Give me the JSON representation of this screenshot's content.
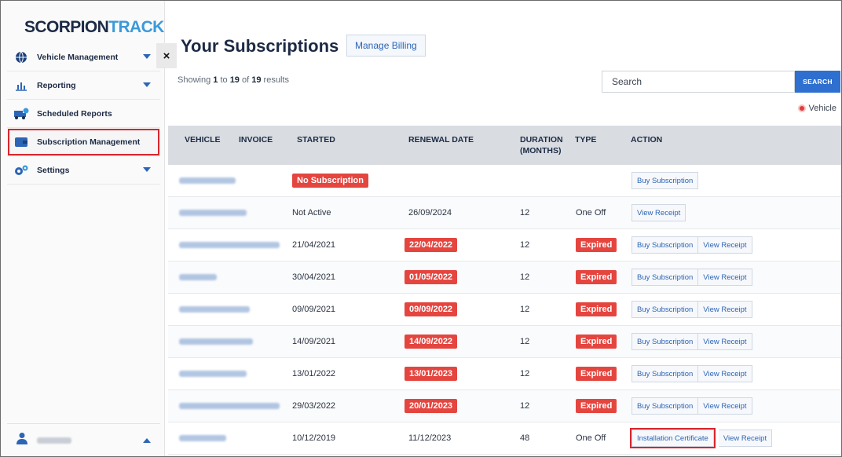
{
  "logo": {
    "part1": "SCORPION",
    "part2": "TRACK"
  },
  "sidebar": {
    "items": [
      {
        "label": "Vehicle Management",
        "icon": "globe-icon",
        "caret": true
      },
      {
        "label": "Reporting",
        "icon": "bar-chart-icon",
        "caret": true
      },
      {
        "label": "Scheduled Reports",
        "icon": "truck-clock-icon",
        "caret": false
      },
      {
        "label": "Subscription Management",
        "icon": "wallet-icon",
        "caret": false,
        "active": true
      },
      {
        "label": "Settings",
        "icon": "gears-icon",
        "caret": true
      }
    ],
    "close": "×"
  },
  "page": {
    "title": "Your Subscriptions",
    "manage_billing": "Manage Billing",
    "showing": {
      "prefix": "Showing ",
      "from": "1",
      "mid1": " to ",
      "to": "19",
      "mid2": " of ",
      "total": "19",
      "suffix": " results"
    },
    "search_placeholder": "Search",
    "search_button": "SEARCH",
    "legend_label": "Vehicle"
  },
  "table": {
    "headers": {
      "vehicle": "VEHICLE",
      "invoice": "INVOICE",
      "started": "STARTED",
      "renewal": "RENEWAL DATE",
      "duration_1": "DURATION",
      "duration_2": "(MONTHS)",
      "type": "TYPE",
      "action": "ACTION"
    },
    "rows": [
      {
        "started": "",
        "started_badge": "No Subscription",
        "renewal": "",
        "renewal_badge": "",
        "duration": "",
        "type": "",
        "type_badge": "",
        "actions": [
          "Buy Subscription"
        ]
      },
      {
        "started": "Not Active",
        "started_badge": "",
        "renewal": "26/09/2024",
        "renewal_badge": "",
        "duration": "12",
        "type": "One Off",
        "type_badge": "",
        "actions": [
          "View Receipt"
        ]
      },
      {
        "started": "21/04/2021",
        "started_badge": "",
        "renewal": "",
        "renewal_badge": "22/04/2022",
        "duration": "12",
        "type": "",
        "type_badge": "Expired",
        "actions": [
          "Buy Subscription",
          "View Receipt"
        ]
      },
      {
        "started": "30/04/2021",
        "started_badge": "",
        "renewal": "",
        "renewal_badge": "01/05/2022",
        "duration": "12",
        "type": "",
        "type_badge": "Expired",
        "actions": [
          "Buy Subscription",
          "View Receipt"
        ]
      },
      {
        "started": "09/09/2021",
        "started_badge": "",
        "renewal": "",
        "renewal_badge": "09/09/2022",
        "duration": "12",
        "type": "",
        "type_badge": "Expired",
        "actions": [
          "Buy Subscription",
          "View Receipt"
        ]
      },
      {
        "started": "14/09/2021",
        "started_badge": "",
        "renewal": "",
        "renewal_badge": "14/09/2022",
        "duration": "12",
        "type": "",
        "type_badge": "Expired",
        "actions": [
          "Buy Subscription",
          "View Receipt"
        ]
      },
      {
        "started": "13/01/2022",
        "started_badge": "",
        "renewal": "",
        "renewal_badge": "13/01/2023",
        "duration": "12",
        "type": "",
        "type_badge": "Expired",
        "actions": [
          "Buy Subscription",
          "View Receipt"
        ]
      },
      {
        "started": "29/03/2022",
        "started_badge": "",
        "renewal": "",
        "renewal_badge": "20/01/2023",
        "duration": "12",
        "type": "",
        "type_badge": "Expired",
        "actions": [
          "Buy Subscription",
          "View Receipt"
        ]
      },
      {
        "started": "10/12/2019",
        "started_badge": "",
        "renewal": "11/12/2023",
        "renewal_badge": "",
        "duration": "48",
        "type": "One Off",
        "type_badge": "",
        "actions": [
          "Installation Certificate",
          "View Receipt"
        ],
        "highlight_first": true
      }
    ]
  },
  "colors": {
    "accent": "#2e6fd0",
    "danger": "#e5453f",
    "highlight": "#d7262e",
    "brand": "#1c2a44"
  }
}
